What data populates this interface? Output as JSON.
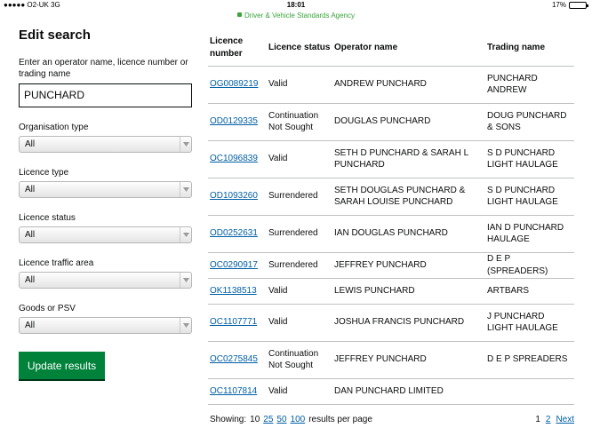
{
  "status_bar": {
    "carrier": "●●●●● O2-UK  3G",
    "time": "18:01",
    "battery": "17%",
    "battery_level": 0.17
  },
  "url_bar": {
    "site": "Driver & Vehicle Standards Agency"
  },
  "search_panel": {
    "title": "Edit search",
    "search_label": "Enter an operator name, licence number or trading name",
    "search_value": "PUNCHARD",
    "filters": [
      {
        "label": "Organisation type",
        "value": "All"
      },
      {
        "label": "Licence type",
        "value": "All"
      },
      {
        "label": "Licence status",
        "value": "All"
      },
      {
        "label": "Licence traffic area",
        "value": "All"
      },
      {
        "label": "Goods or PSV",
        "value": "All"
      }
    ],
    "update_button": "Update results"
  },
  "results": {
    "headers": [
      "Licence number",
      "Licence status",
      "Operator name",
      "Trading name"
    ],
    "rows": [
      {
        "licence": "OG0089219",
        "status": "Valid",
        "operator": "ANDREW PUNCHARD",
        "trading": "PUNCHARD ANDREW"
      },
      {
        "licence": "OD0129335",
        "status": "Continuation Not Sought",
        "operator": "DOUGLAS PUNCHARD",
        "trading": "DOUG PUNCHARD & SONS"
      },
      {
        "licence": "OC1096839",
        "status": "Valid",
        "operator": "SETH D PUNCHARD & SARAH L PUNCHARD",
        "trading": "S D PUNCHARD LIGHT HAULAGE"
      },
      {
        "licence": "OD1093260",
        "status": "Surrendered",
        "operator": "SETH DOUGLAS PUNCHARD & SARAH LOUISE PUNCHARD",
        "trading": "S D PUNCHARD LIGHT HAULAGE"
      },
      {
        "licence": "OD0252631",
        "status": "Surrendered",
        "operator": "IAN DOUGLAS PUNCHARD",
        "trading": "IAN D PUNCHARD HAULAGE"
      },
      {
        "licence": "OC0290917",
        "status": "Surrendered",
        "operator": "JEFFREY PUNCHARD",
        "trading": "D E P (SPREADERS)"
      },
      {
        "licence": "OK1138513",
        "status": "Valid",
        "operator": "LEWIS PUNCHARD",
        "trading": "ARTBARS"
      },
      {
        "licence": "OC1107771",
        "status": "Valid",
        "operator": "JOSHUA FRANCIS PUNCHARD",
        "trading": "J PUNCHARD LIGHT HAULAGE"
      },
      {
        "licence": "OC0275845",
        "status": "Continuation Not Sought",
        "operator": "JEFFREY PUNCHARD",
        "trading": "D E P SPREADERS"
      },
      {
        "licence": "OC1107814",
        "status": "Valid",
        "operator": "DAN PUNCHARD LIMITED",
        "trading": ""
      }
    ]
  },
  "pagination": {
    "showing_label": "Showing:",
    "current_size": "10",
    "size_options": [
      "25",
      "50",
      "100"
    ],
    "per_page_label": "results per page",
    "current_page": "1",
    "page_link": "2",
    "next_label": "Next"
  }
}
